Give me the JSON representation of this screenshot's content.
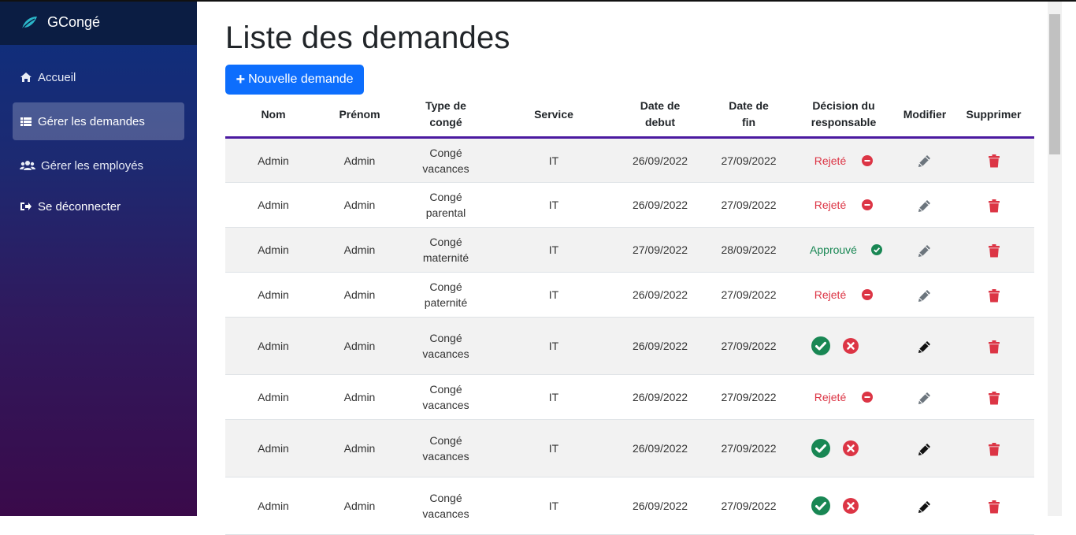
{
  "brand": {
    "name": "GCongé"
  },
  "sidebar": {
    "items": [
      {
        "label": "Accueil",
        "icon": "home-icon"
      },
      {
        "label": "Gérer les demandes",
        "icon": "list-icon"
      },
      {
        "label": "Gérer les employés",
        "icon": "users-icon"
      },
      {
        "label": "Se déconnecter",
        "icon": "logout-icon"
      }
    ]
  },
  "main": {
    "title": "Liste des demandes",
    "new_button": "Nouvelle demande",
    "table": {
      "headers": [
        "Nom",
        "Prénom",
        "Type de congé",
        "Service",
        "Date de debut",
        "Date de fin",
        "Décision du responsable",
        "Modifier",
        "Supprimer"
      ],
      "headers_lines": [
        [
          "Nom"
        ],
        [
          "Prénom"
        ],
        [
          "Type de",
          "congé"
        ],
        [
          "Service"
        ],
        [
          "Date de",
          "debut"
        ],
        [
          "Date de",
          "fin"
        ],
        [
          "Décision du",
          "responsable"
        ],
        [
          "Modifier"
        ],
        [
          "Supprimer"
        ]
      ],
      "rows": [
        {
          "nom": "Admin",
          "prenom": "Admin",
          "type": [
            "Congé",
            "vacances"
          ],
          "service": "IT",
          "debut": "26/09/2022",
          "fin": "27/09/2022",
          "decision": "Rejeté",
          "status": "rejected"
        },
        {
          "nom": "Admin",
          "prenom": "Admin",
          "type": [
            "Congé",
            "parental"
          ],
          "service": "IT",
          "debut": "26/09/2022",
          "fin": "27/09/2022",
          "decision": "Rejeté",
          "status": "rejected"
        },
        {
          "nom": "Admin",
          "prenom": "Admin",
          "type": [
            "Congé",
            "maternité"
          ],
          "service": "IT",
          "debut": "27/09/2022",
          "fin": "28/09/2022",
          "decision": "Approuvé",
          "status": "approved"
        },
        {
          "nom": "Admin",
          "prenom": "Admin",
          "type": [
            "Congé",
            "paternité"
          ],
          "service": "IT",
          "debut": "26/09/2022",
          "fin": "27/09/2022",
          "decision": "Rejeté",
          "status": "rejected"
        },
        {
          "nom": "Admin",
          "prenom": "Admin",
          "type": [
            "Congé",
            "vacances"
          ],
          "service": "IT",
          "debut": "26/09/2022",
          "fin": "27/09/2022",
          "decision": "",
          "status": "pending"
        },
        {
          "nom": "Admin",
          "prenom": "Admin",
          "type": [
            "Congé",
            "vacances"
          ],
          "service": "IT",
          "debut": "26/09/2022",
          "fin": "27/09/2022",
          "decision": "Rejeté",
          "status": "rejected"
        },
        {
          "nom": "Admin",
          "prenom": "Admin",
          "type": [
            "Congé",
            "vacances"
          ],
          "service": "IT",
          "debut": "26/09/2022",
          "fin": "27/09/2022",
          "decision": "",
          "status": "pending"
        },
        {
          "nom": "Admin",
          "prenom": "Admin",
          "type": [
            "Congé",
            "vacances"
          ],
          "service": "IT",
          "debut": "26/09/2022",
          "fin": "27/09/2022",
          "decision": "",
          "status": "pending"
        }
      ]
    }
  },
  "colors": {
    "primary": "#0d6efd",
    "rejected": "#dc3545",
    "approved": "#198754",
    "header_border": "#4b1aa0",
    "stripe": "#f2f2f2"
  }
}
